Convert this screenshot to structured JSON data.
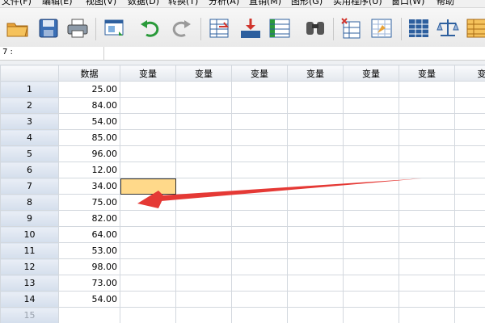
{
  "menu": [
    {
      "label": "文件(F)"
    },
    {
      "label": "编辑(E)"
    },
    {
      "label": "视图(V)"
    },
    {
      "label": "数据(D)"
    },
    {
      "label": "转换(T)"
    },
    {
      "label": "分析(A)"
    },
    {
      "label": "直销(M)"
    },
    {
      "label": "图形(G)"
    },
    {
      "label": "实用程序(U)"
    },
    {
      "label": "窗口(W)"
    },
    {
      "label": "帮助"
    }
  ],
  "toolbar": {
    "icons": [
      "open-folder-icon",
      "save-icon",
      "print-icon",
      "dialog-recall-icon",
      "undo-icon",
      "redo-icon",
      "goto-case-icon",
      "goto-variable-icon",
      "variables-icon",
      "find-icon",
      "insert-cases-icon",
      "insert-variable-icon",
      "split-file-icon",
      "weight-cases-icon",
      "select-cases-icon"
    ]
  },
  "cell_editor": {
    "reference": "7 :",
    "value": ""
  },
  "grid": {
    "columns": [
      "数据",
      "变量",
      "变量",
      "变量",
      "变量",
      "变量",
      "变量",
      "变量"
    ],
    "rows": [
      {
        "num": "1",
        "value": "25.00"
      },
      {
        "num": "2",
        "value": "84.00"
      },
      {
        "num": "3",
        "value": "54.00"
      },
      {
        "num": "4",
        "value": "85.00"
      },
      {
        "num": "5",
        "value": "96.00"
      },
      {
        "num": "6",
        "value": "12.00"
      },
      {
        "num": "7",
        "value": "34.00"
      },
      {
        "num": "8",
        "value": "75.00"
      },
      {
        "num": "9",
        "value": "82.00"
      },
      {
        "num": "10",
        "value": "64.00"
      },
      {
        "num": "11",
        "value": "53.00"
      },
      {
        "num": "12",
        "value": "98.00"
      },
      {
        "num": "13",
        "value": "73.00"
      },
      {
        "num": "14",
        "value": "54.00"
      },
      {
        "num": "15",
        "value": ""
      }
    ],
    "selected_cell": {
      "row": "7",
      "column": "变量"
    }
  },
  "colors": {
    "selected_cell": "#ffd98a",
    "arrow": "#e53935",
    "row_header": "#d4deec"
  }
}
